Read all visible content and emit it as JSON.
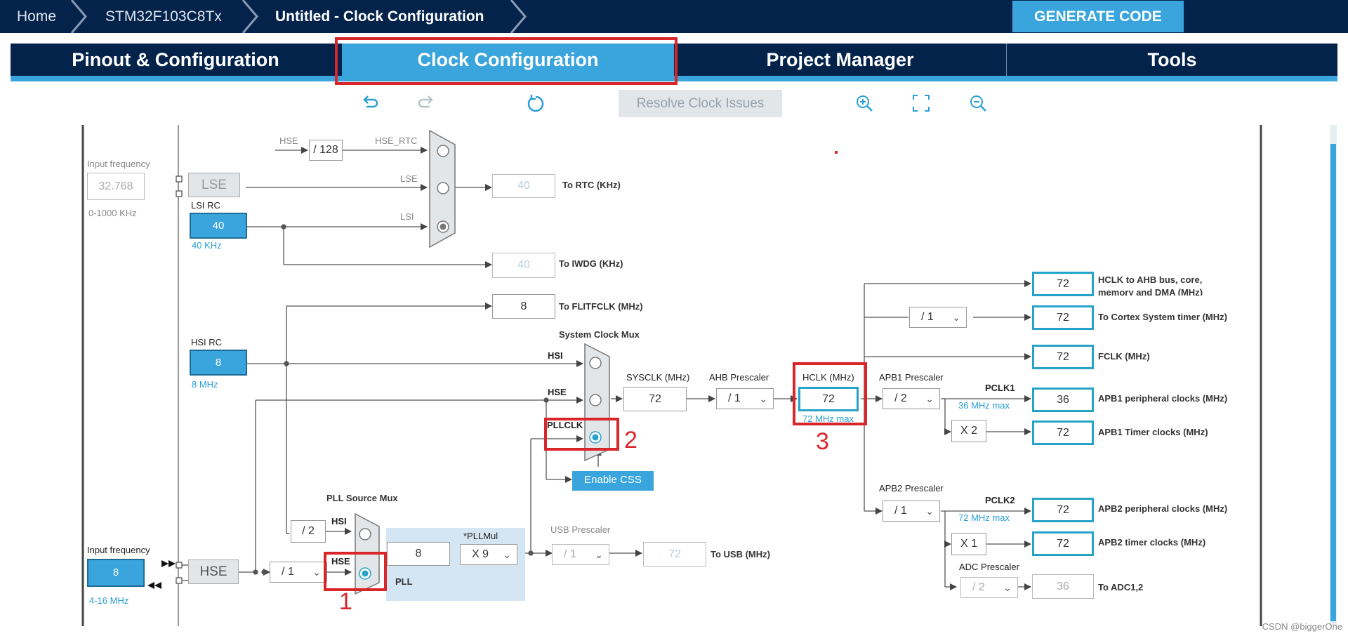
{
  "breadcrumb": {
    "home": "Home",
    "device": "STM32F103C8Tx",
    "project": "Untitled - Clock Configuration"
  },
  "generate_button": "GENERATE CODE",
  "tabs": [
    {
      "label": "Pinout & Configuration"
    },
    {
      "label": "Clock Configuration",
      "active": true
    },
    {
      "label": "Project Manager"
    },
    {
      "label": "Tools"
    }
  ],
  "toolbar": {
    "resolve": "Resolve Clock Issues",
    "icons": [
      "undo-icon",
      "redo-icon",
      "reset-icon",
      "zoom-in-icon",
      "fit-icon",
      "zoom-out-icon"
    ]
  },
  "lse": {
    "input_frequency_label": "Input frequency",
    "value": "32.768",
    "range": "0-1000 KHz",
    "box": "LSE"
  },
  "lsi": {
    "title": "LSI RC",
    "value": "40",
    "sub": "40 KHz"
  },
  "rtc": {
    "hse_label": "HSE",
    "div_value": "/ 128",
    "hse_rtc": "HSE_RTC",
    "lse_label": "LSE",
    "lsi_label": "LSI",
    "value": "40",
    "label": "To RTC (KHz)"
  },
  "iwdg": {
    "value": "40",
    "label": "To IWDG (KHz)"
  },
  "flitf": {
    "value": "8",
    "label": "To FLITFCLK (MHz)"
  },
  "hsi": {
    "title": "HSI RC",
    "value": "8",
    "sub": "8 MHz"
  },
  "sysmux": {
    "title": "System Clock Mux",
    "hsi": "HSI",
    "hse": "HSE",
    "pllclk": "PLLCLK",
    "css_button": "Enable CSS"
  },
  "sysclk": {
    "label": "SYSCLK (MHz)",
    "value": "72"
  },
  "ahb": {
    "label": "AHB Prescaler",
    "value": "/ 1"
  },
  "hclk": {
    "label": "HCLK (MHz)",
    "value": "72",
    "max": "72 MHz max"
  },
  "apb1": {
    "label": "APB1 Prescaler",
    "value": "/ 2",
    "pclk": "PCLK1",
    "max": "36 MHz max",
    "timer_mul": "X 2"
  },
  "apb2": {
    "label": "APB2 Prescaler",
    "value": "/ 1",
    "pclk": "PCLK2",
    "max": "72 MHz max",
    "timer_mul": "X 1"
  },
  "adc": {
    "label": "ADC Prescaler",
    "value": "/ 2",
    "out": "36",
    "out_label": "To ADC1,2"
  },
  "cortex_div": "/ 1",
  "outputs": [
    {
      "value": "72",
      "label": "HCLK to AHB bus, core,",
      "label2": "memory and DMA (MHz)"
    },
    {
      "value": "72",
      "label": "To Cortex System timer (MHz)"
    },
    {
      "value": "72",
      "label": "FCLK (MHz)"
    },
    {
      "value": "36",
      "label": "APB1 peripheral clocks (MHz)"
    },
    {
      "value": "72",
      "label": "APB1 Timer clocks (MHz)"
    },
    {
      "value": "72",
      "label": "APB2 peripheral clocks (MHz)"
    },
    {
      "value": "72",
      "label": "APB2 timer clocks (MHz)"
    }
  ],
  "pll": {
    "source_mux": "PLL Source Mux",
    "hsi_div": "/ 2",
    "hsi": "HSI",
    "hse": "HSE",
    "value": "8",
    "mul_label": "*PLLMul",
    "mul": "X 9",
    "label": "PLL"
  },
  "usb": {
    "label": "USB Prescaler",
    "value": "/ 1",
    "out": "72",
    "out_label": "To USB (MHz)"
  },
  "hse": {
    "input_frequency_label": "Input frequency",
    "value": "8",
    "range": "4-16 MHz",
    "box": "HSE",
    "div": "/ 1"
  },
  "annotations": [
    "1",
    "2",
    "3"
  ],
  "watermark": "CSDN @biggerOne",
  "colors": {
    "navy": "#03234b",
    "accent": "#39a5dc",
    "highlight": "#d9262b",
    "teal": "#27a2c9"
  }
}
